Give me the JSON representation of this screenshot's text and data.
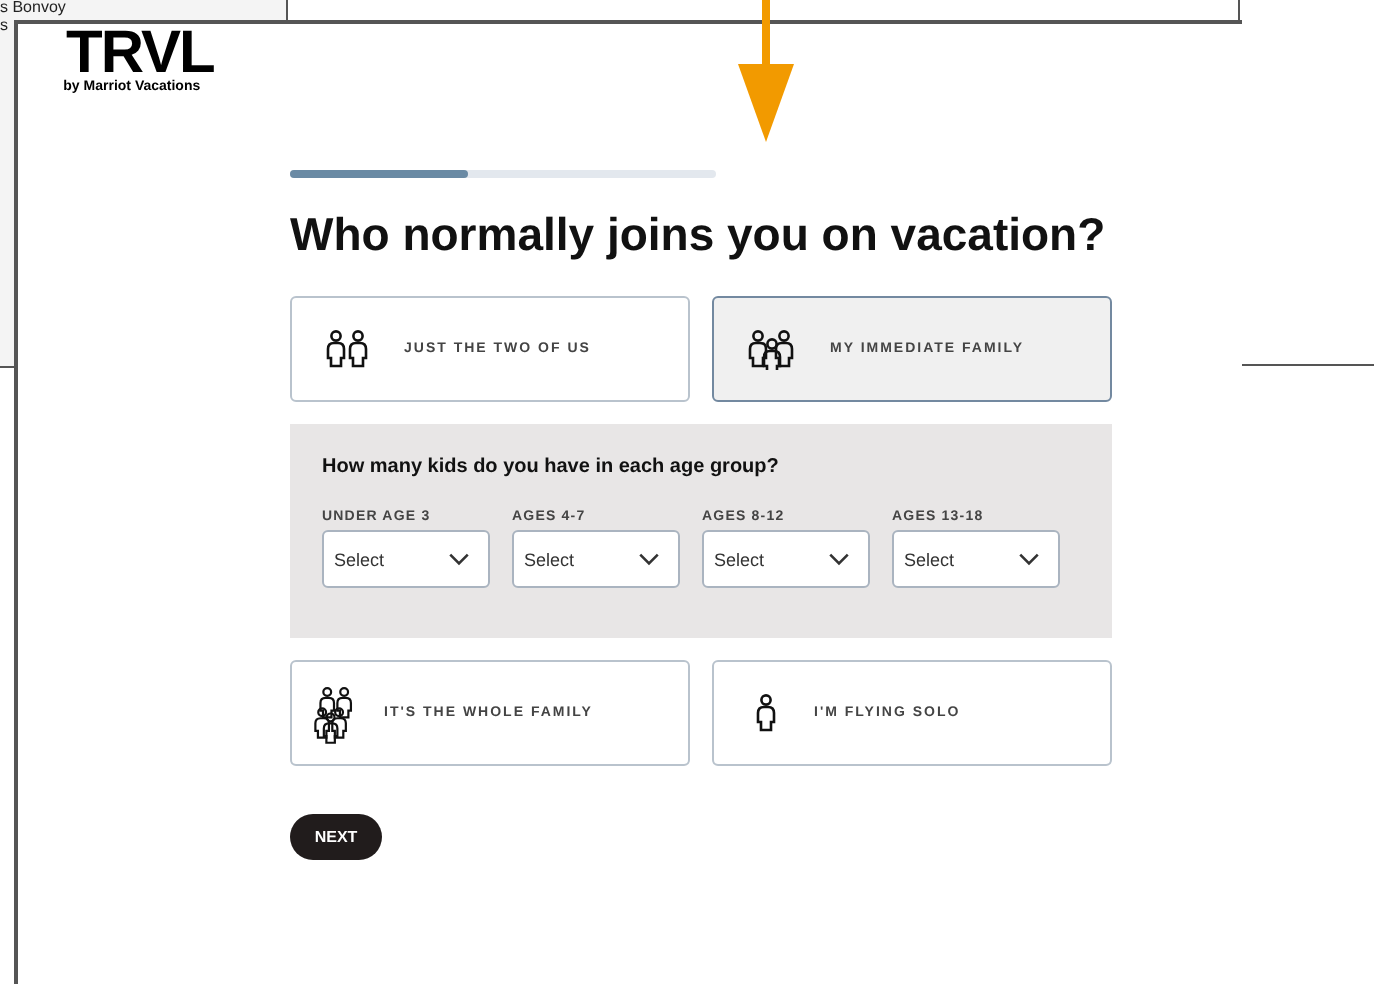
{
  "background_window": {
    "lines": [
      "s Bonvoy",
      "s"
    ]
  },
  "logo": {
    "wordmark": "TRVL",
    "tagline": "by Marriot Vacations"
  },
  "progress": {
    "level": 0.42
  },
  "heading": "Who normally joins you on vacation?",
  "options": [
    {
      "label": "JUST THE TWO OF US",
      "kind": "couple",
      "selected": false
    },
    {
      "label": "MY IMMEDIATE FAMILY",
      "kind": "family",
      "selected": true
    }
  ],
  "kids_panel": {
    "question": "How many kids do you have in each age group?",
    "fields": [
      {
        "label": "UNDER AGE 3",
        "value": "Select"
      },
      {
        "label": "AGES 4-7",
        "value": "Select"
      },
      {
        "label": "AGES 8-12",
        "value": "Select"
      },
      {
        "label": "AGES 13-18",
        "value": "Select"
      }
    ]
  },
  "more_options": [
    {
      "label": "IT'S THE WHOLE FAMILY",
      "kind": "whole",
      "selected": false
    },
    {
      "label": "I'M FLYING SOLO",
      "kind": "solo",
      "selected": false
    }
  ],
  "next_button": "NEXT"
}
